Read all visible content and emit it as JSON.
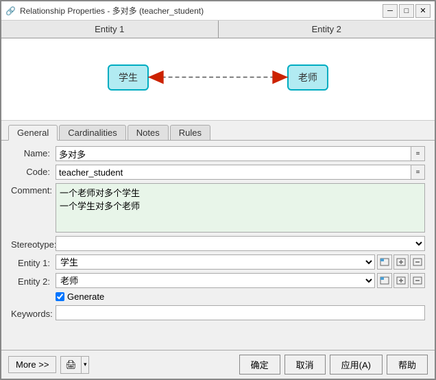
{
  "window": {
    "title": "Relationship Properties - 多对多 (teacher_student)",
    "icon": "🔗"
  },
  "title_buttons": {
    "minimize": "─",
    "maximize": "□",
    "close": "✕"
  },
  "entity_tabs": {
    "tab1": "Entity 1",
    "tab2": "Entity 2"
  },
  "diagram": {
    "entity1_label": "学生",
    "entity2_label": "老师"
  },
  "tabs": [
    {
      "id": "general",
      "label": "General",
      "active": true
    },
    {
      "id": "cardinalities",
      "label": "Cardinalities",
      "active": false
    },
    {
      "id": "notes",
      "label": "Notes",
      "active": false
    },
    {
      "id": "rules",
      "label": "Rules",
      "active": false
    }
  ],
  "form": {
    "name_label": "Name:",
    "name_value": "多对多",
    "code_label": "Code:",
    "code_value": "teacher_student",
    "comment_label": "Comment:",
    "comment_value": "一个老师对多个学生\n一个学生对多个老师",
    "stereotype_label": "Stereotype:",
    "stereotype_value": "",
    "entity1_label": "Entity 1:",
    "entity1_value": "学生",
    "entity2_label": "Entity 2:",
    "entity2_value": "老师",
    "generate_label": "Generate",
    "generate_checked": true,
    "keywords_label": "Keywords:",
    "keywords_value": "",
    "btn_ellipsis": "=",
    "btn_dropdown": "▾"
  },
  "bottom_bar": {
    "more_label": "More >>",
    "print_icon": "🖨",
    "confirm_label": "确定",
    "cancel_label": "取消",
    "apply_label": "应用(A)",
    "help_label": "帮助"
  }
}
